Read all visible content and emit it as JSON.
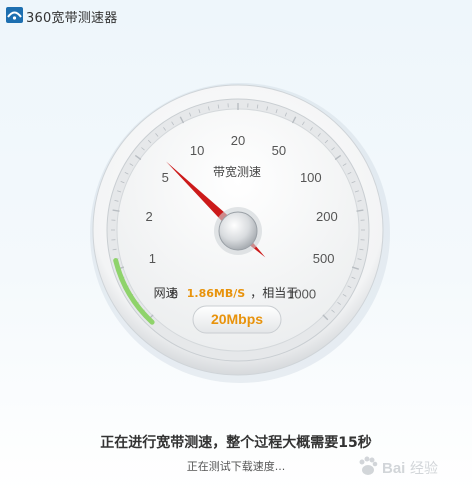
{
  "window": {
    "title": "360宽带测速器"
  },
  "gauge": {
    "caption": "带宽测速",
    "ticks": [
      "0",
      "1",
      "2",
      "5",
      "10",
      "20",
      "50",
      "100",
      "200",
      "500",
      "1000"
    ],
    "rate_prefix": "网速",
    "rate_value": "1.86MB/S",
    "rate_suffix": "，相当于",
    "bandwidth": "20Mbps",
    "needle_value": 5,
    "colors": {
      "needle": "#cc1a1a",
      "accent": "#e8930c",
      "progress": "#8fd36b"
    }
  },
  "status": {
    "main": "正在进行宽带测速，整个过程大概需要15秒",
    "sub": "正在测试下载速度..."
  },
  "watermark": {
    "icon": "baidu-paw-icon",
    "text": "经验"
  }
}
